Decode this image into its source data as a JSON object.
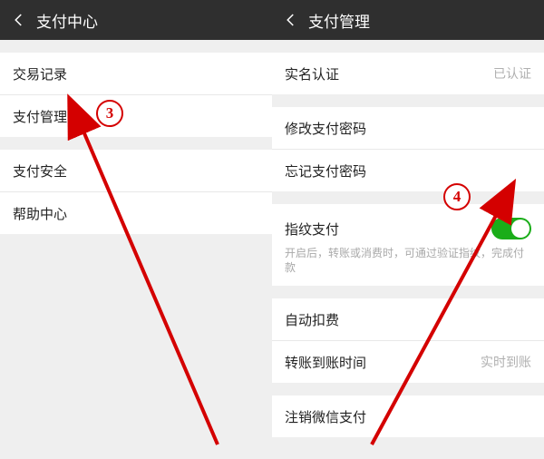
{
  "annotations": {
    "step3": "3",
    "step4": "4"
  },
  "left": {
    "header": {
      "title": "支付中心"
    },
    "rows": {
      "transactions": "交易记录",
      "payment_manage": "支付管理",
      "payment_security": "支付安全",
      "help_center": "帮助中心"
    }
  },
  "right": {
    "header": {
      "title": "支付管理"
    },
    "rows": {
      "real_name": {
        "label": "实名认证",
        "value": "已认证"
      },
      "change_pwd": "修改支付密码",
      "forgot_pwd": "忘记支付密码",
      "fingerprint": {
        "label": "指纹支付",
        "desc": "开启后，转账或消费时，可通过验证指纹，完成付款",
        "on": true
      },
      "auto_debit": "自动扣费",
      "transfer_time": {
        "label": "转账到账时间",
        "value": "实时到账"
      },
      "logout": "注销微信支付"
    }
  }
}
